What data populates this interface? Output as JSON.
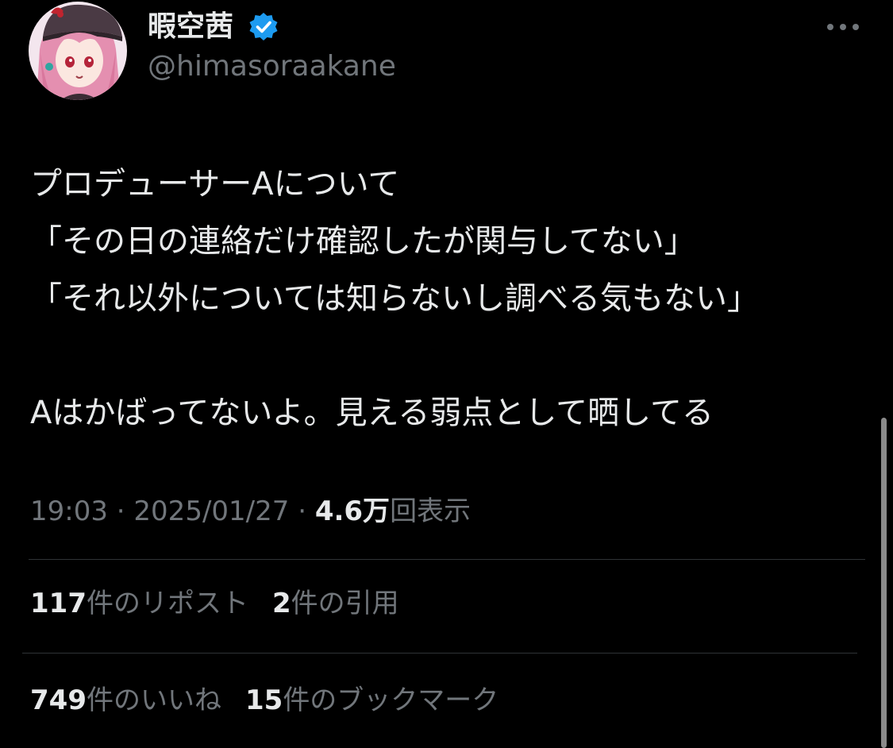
{
  "author": {
    "display_name": "暇空茜",
    "handle": "@himasoraakane",
    "verified_color": "#1d9bf0"
  },
  "icons": {
    "verified": "verified-badge-icon",
    "more": "more-options-icon",
    "avatar": "avatar-illustration"
  },
  "tweet": {
    "lines": [
      "プロデューサーAについて",
      "「その日の連絡だけ確認したが関与してない」",
      "「それ以外については知らないし調べる気もない」",
      "",
      "Aはかばってないよ。見える弱点として晒してる"
    ]
  },
  "meta": {
    "time": "19:03",
    "separator": " · ",
    "date": "2025/01/27",
    "views_count": "4.6万",
    "views_label": "回表示"
  },
  "stats": {
    "reposts": {
      "count": "117",
      "label": "件のリポスト"
    },
    "quotes": {
      "count": "2",
      "label": "件の引用"
    },
    "likes": {
      "count": "749",
      "label": "件のいいね"
    },
    "bookmarks": {
      "count": "15",
      "label": "件のブックマーク"
    }
  }
}
